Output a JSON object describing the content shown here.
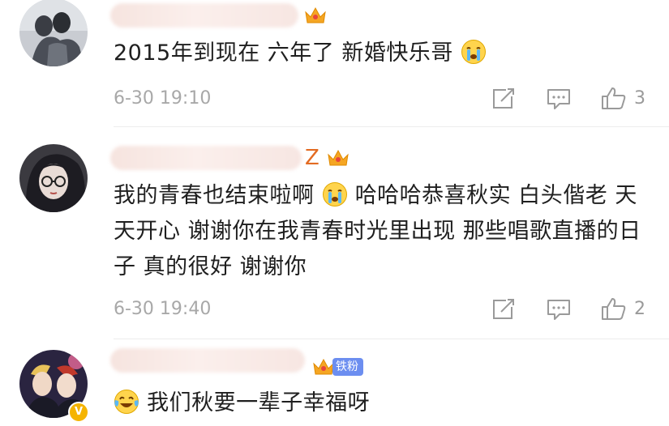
{
  "comments": [
    {
      "text": "2015年到现在 六年了 新婚快乐哥",
      "time": "6-30 19:10",
      "likes": "3",
      "emoji": "crying-face-icon"
    },
    {
      "name_tail": "Z",
      "text_part1": "我的青春也结束啦啊",
      "text_part2": "哈哈哈恭喜秋实 白头偕老 天天开心 谢谢你在我青春时光里出现 那些唱歌直播的日子 真的很好 谢谢你",
      "time": "6-30 19:40",
      "likes": "2",
      "emoji": "crying-face-icon"
    },
    {
      "fan_badge": "铁粉",
      "text": "我们秋要一辈子幸福呀",
      "emoji": "tears-of-joy-icon"
    }
  ],
  "colors": {
    "crown": "#f5a623",
    "fan_badge": "#6c8ef0",
    "timestamp": "#a8a8a8",
    "name_tail": "#e36b22"
  }
}
